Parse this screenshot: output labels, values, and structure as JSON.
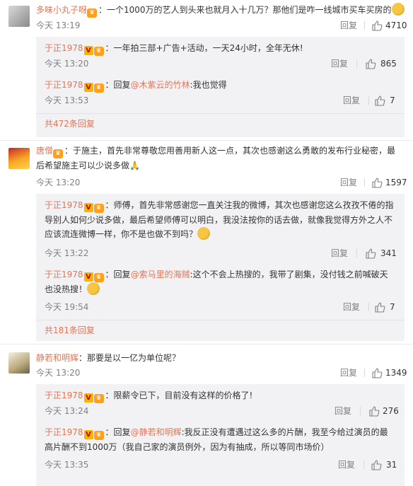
{
  "comments": [
    {
      "user": "多味小丸子呀",
      "text": "：一个1000万的艺人到头来也就月入十几万？那他们是咋一线城市买车买房的",
      "time": "今天 13:19",
      "reply_label": "回复",
      "likes": "4710",
      "replies": [
        {
          "user": "于正1978",
          "prefix": "",
          "mention": "",
          "text": "：一年拍三部+广告+活动，一天24小时，全年无休!",
          "time": "今天 13:20",
          "reply_label": "回复",
          "likes": "865"
        },
        {
          "user": "于正1978",
          "prefix": "：回复",
          "mention": "@木紫云的竹林",
          "text": ":我也觉得",
          "time": "今天 13:53",
          "reply_label": "回复",
          "likes": "7"
        }
      ],
      "more": "共472条回复"
    },
    {
      "user": "唐僧",
      "text_1": "：于施主，首先非常尊敬您用善用新人这一点，其次也感谢这么勇敢的发布行业秘密，最",
      "text_2": "后希望施主可以少说多做",
      "time": "今天 13:20",
      "reply_label": "回复",
      "likes": "1597",
      "replies": [
        {
          "user": "于正1978",
          "text_1": "：师傅，首先非常感谢您一直关注我的微博，其次也感谢您这么孜孜不倦的指",
          "text_2": "导别人如何少说多做，最后希望师傅可以明白，我没法按你的话去做，就像我觉得方外之人不",
          "text_3": "应该流连微博一样，你不是也做不到吗？",
          "time": "今天 13:22",
          "reply_label": "回复",
          "likes": "341"
        },
        {
          "user": "于正1978",
          "prefix": "：回复",
          "mention": "@索马里的海贼",
          "text_1": ":这个不会上热搜的，我带了剧集，没付钱之前喊破天",
          "text_2": "也没热搜！",
          "time": "今天 19:54",
          "reply_label": "回复",
          "likes": "7"
        }
      ],
      "more": "共181条回复"
    },
    {
      "user": "静若和明辉",
      "text": "：那要是以一亿为单位呢？",
      "time": "今天 13:20",
      "reply_label": "回复",
      "likes": "1349",
      "replies": [
        {
          "user": "于正1978",
          "text": "：限薪令已下，目前没有这样的价格了!",
          "time": "今天 13:24",
          "reply_label": "回复",
          "likes": "276"
        },
        {
          "user": "于正1978",
          "prefix": "：回复",
          "mention": "@静若和明辉",
          "text_1": ":我反正没有遭遇过这么多的片酬，我至今给过演员的最",
          "text_2": "高片酬不到1000万（我自己家的演员例外，因为有抽成，所以等同市场价）",
          "time": "今天 13:35",
          "reply_label": "回复",
          "likes": "31"
        }
      ]
    }
  ]
}
